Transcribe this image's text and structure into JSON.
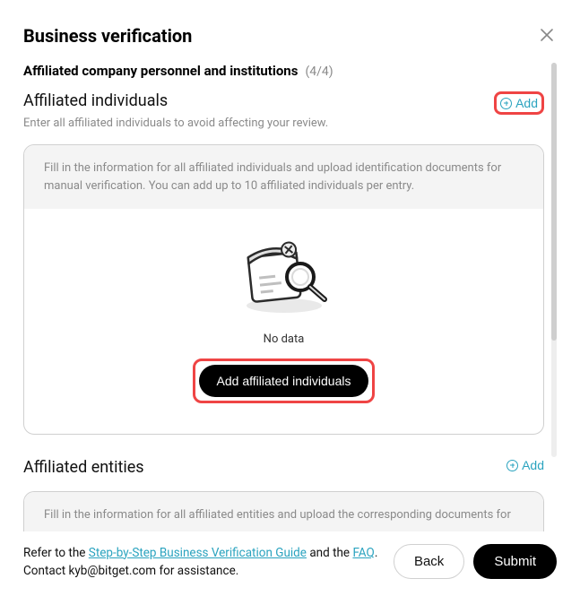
{
  "modal": {
    "title": "Business verification"
  },
  "step": {
    "title": "Affiliated company personnel and institutions",
    "count": "(4/4)"
  },
  "section1": {
    "title": "Affiliated individuals",
    "subtitle": "Enter all affiliated individuals to avoid affecting your review.",
    "add_label": "Add",
    "panel_note": "Fill in the information for all affiliated individuals and upload identification documents for manual verification. You can add up to 10 affiliated individuals per entry.",
    "no_data": "No data",
    "add_button": "Add affiliated individuals"
  },
  "section2": {
    "title": "Affiliated entities",
    "add_label": "Add",
    "panel_note": "Fill in the information for all affiliated entities and upload the corresponding documents for"
  },
  "footer": {
    "pre": "Refer to the ",
    "link1": "Step-by-Step Business Verification Guide",
    "mid": " and the ",
    "link2": "FAQ",
    "post1": ". Contact ",
    "email": "kyb@bitget.com",
    "post2": " for assistance.",
    "back": "Back",
    "submit": "Submit"
  }
}
